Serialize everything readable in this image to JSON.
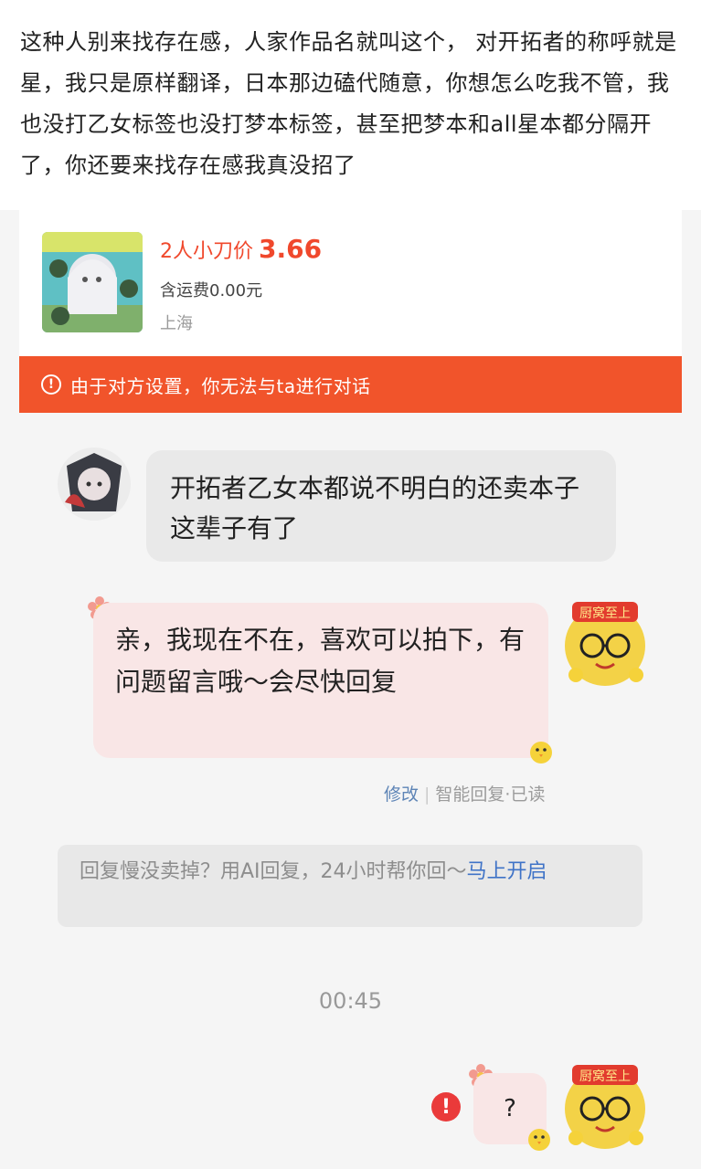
{
  "post": {
    "text": "这种人别来找存在感，人家作品名就叫这个， 对开拓者的称呼就是星，我只是原样翻译，日本那边磕代随意，你想怎么吃我不管，我也没打乙女标签也没打梦本标签，甚至把梦本和all星本都分隔开了，你还要来找存在感我真没招了"
  },
  "product": {
    "price_prefix": "2人小刀价",
    "price": "3.66",
    "shipping": "含运费0.00元",
    "location": "上海"
  },
  "banner": {
    "icon_glyph": "!",
    "text": "由于对方设置，你无法与ta进行对话"
  },
  "messages": {
    "buyer_message": "开拓者乙女本都说不明白的还卖本子这辈子有了",
    "seller_auto_reply": "亲，我现在不在，喜欢可以拍下，有问题留言哦～会尽快回复",
    "edit_label": "修改",
    "status_label": "智能回复·已读",
    "seller_question": "?",
    "error_glyph": "!"
  },
  "ai_promo": {
    "text": "回复慢没卖掉？用AI回复，24小时帮你回～",
    "link": "马上开启"
  },
  "timestamp": "00:45",
  "avatar_badge": "厨窝至上",
  "colors": {
    "accent_red": "#f1542b",
    "price_red": "#f0482c",
    "link_blue": "#3f73c7",
    "bubble_pink": "#f9e6e6",
    "bubble_gray": "#e9e9e9"
  }
}
